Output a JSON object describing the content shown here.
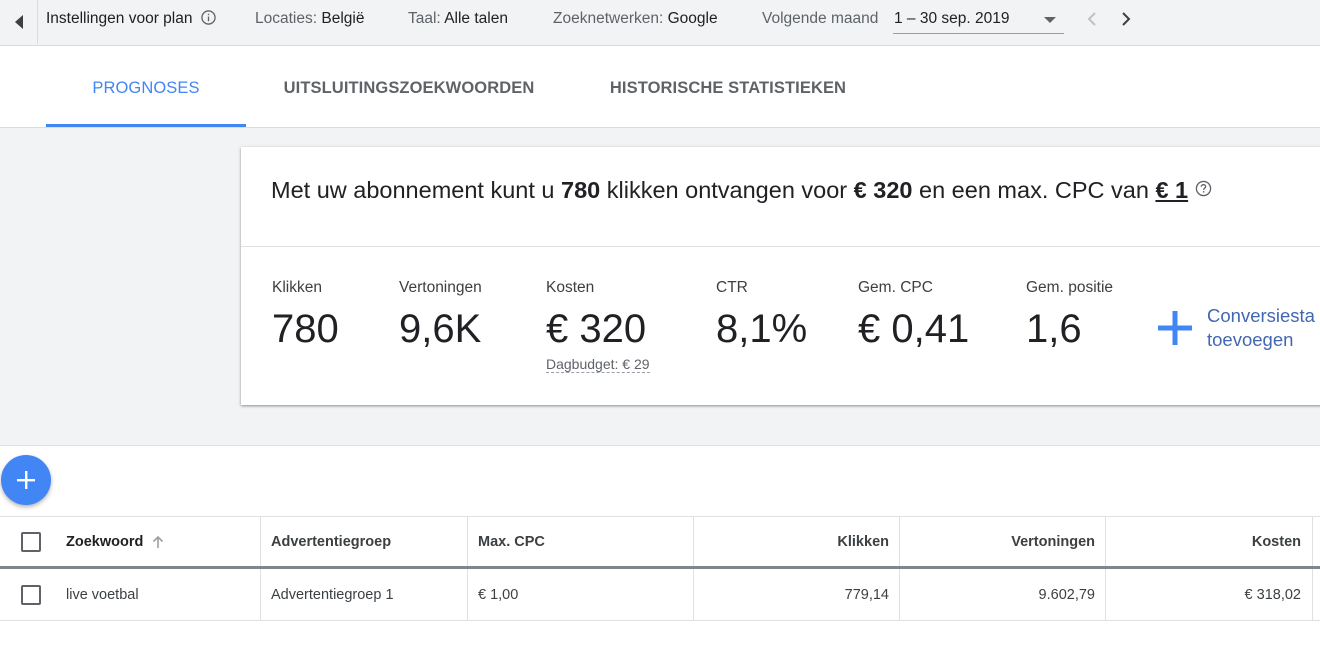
{
  "topbar": {
    "plan_settings_label": "Instellingen voor plan",
    "locations_label": "Locaties:",
    "locations_value": "België",
    "language_label": "Taal:",
    "language_value": "Alle talen",
    "networks_label": "Zoeknetwerken:",
    "networks_value": "Google",
    "period_label": "Volgende maand",
    "date_range": "1 – 30 sep. 2019"
  },
  "tabs": [
    {
      "label": "PROGNOSES",
      "active": true
    },
    {
      "label": "UITSLUITINGSZOEKWOORDEN",
      "active": false
    },
    {
      "label": "HISTORISCHE STATISTIEKEN",
      "active": false
    }
  ],
  "summary": {
    "part1": "Met uw abonnement kunt u ",
    "clicks": "780",
    "part2": " klikken ontvangen voor ",
    "cost": "€ 320",
    "part3": " en een max. CPC van ",
    "max_cpc": "€ 1"
  },
  "metrics": [
    {
      "label": "Klikken",
      "value": "780"
    },
    {
      "label": "Vertoningen",
      "value": "9,6K"
    },
    {
      "label": "Kosten",
      "value": "€ 320"
    },
    {
      "label": "CTR",
      "value": "8,1%"
    },
    {
      "label": "Gem. CPC",
      "value": "€ 0,41"
    },
    {
      "label": "Gem. positie",
      "value": "1,6"
    }
  ],
  "budget_text": "Dagbudget: € 29",
  "add_conversion": {
    "line1": "Conversiesta",
    "line2": "toevoegen"
  },
  "table": {
    "headers": [
      "Zoekwoord",
      "Advertentiegroep",
      "Max. CPC",
      "Klikken",
      "Vertoningen",
      "Kosten"
    ],
    "rows": [
      [
        "live voetbal",
        "Advertentiegroep 1",
        "€ 1,00",
        "779,14",
        "9.602,79",
        "€ 318,02"
      ]
    ]
  },
  "colors": {
    "accent": "#4285f4",
    "link": "#4267b2",
    "background_grey": "#f1f3f4"
  }
}
